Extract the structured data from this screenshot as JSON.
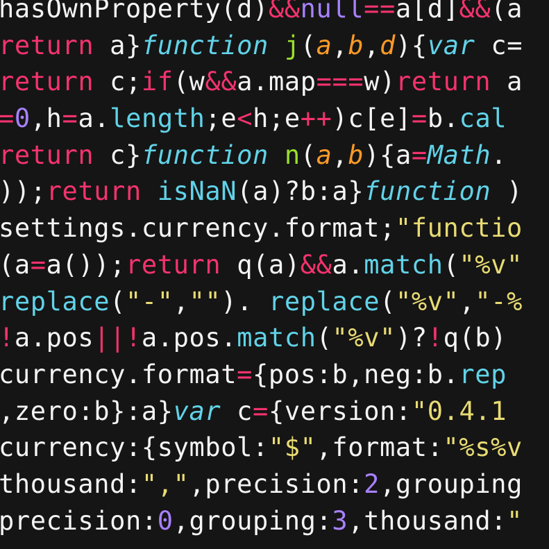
{
  "palette": {
    "background": "#151515",
    "plain": "#f4f4f4",
    "keyword": "#f4336e",
    "function_kw": "#61d3e8",
    "function_name": "#9ae02c",
    "param": "#fb9a28",
    "literal": "#a881ff",
    "string": "#e8db74"
  },
  "lines": [
    [
      [
        "plain",
        "hasOwnProperty(d)"
      ],
      [
        "op",
        "&&"
      ],
      [
        "lit",
        "null"
      ],
      [
        "op",
        "=="
      ],
      [
        "plain",
        "a[d]"
      ],
      [
        "op",
        "&&"
      ],
      [
        "plain",
        "(a"
      ]
    ],
    [
      [
        "kw",
        "return"
      ],
      [
        "plain",
        " a}"
      ],
      [
        "fn",
        "function"
      ],
      [
        "plain",
        " "
      ],
      [
        "name",
        "j"
      ],
      [
        "plain",
        "("
      ],
      [
        "param",
        "a"
      ],
      [
        "plain",
        ","
      ],
      [
        "param",
        "b"
      ],
      [
        "plain",
        ","
      ],
      [
        "param",
        "d"
      ],
      [
        "plain",
        "){"
      ],
      [
        "fn",
        "var"
      ],
      [
        "plain",
        " c="
      ]
    ],
    [
      [
        "kw",
        "return"
      ],
      [
        "plain",
        " c;"
      ],
      [
        "kw",
        "if"
      ],
      [
        "plain",
        "(w"
      ],
      [
        "op",
        "&&"
      ],
      [
        "plain",
        "a.map"
      ],
      [
        "op",
        "==="
      ],
      [
        "plain",
        "w)"
      ],
      [
        "kw",
        "return"
      ],
      [
        "plain",
        " a"
      ]
    ],
    [
      [
        "op",
        "="
      ],
      [
        "num",
        "0"
      ],
      [
        "plain",
        ",h"
      ],
      [
        "op",
        "="
      ],
      [
        "plain",
        "a."
      ],
      [
        "call",
        "length"
      ],
      [
        "plain",
        ";e"
      ],
      [
        "op",
        "<"
      ],
      [
        "plain",
        "h;e"
      ],
      [
        "op",
        "++"
      ],
      [
        "plain",
        ")c[e]"
      ],
      [
        "op",
        "="
      ],
      [
        "plain",
        "b."
      ],
      [
        "call",
        "cal"
      ]
    ],
    [
      [
        "kw",
        "return"
      ],
      [
        "plain",
        " c}"
      ],
      [
        "fn",
        "function"
      ],
      [
        "plain",
        " "
      ],
      [
        "name",
        "n"
      ],
      [
        "plain",
        "("
      ],
      [
        "param",
        "a"
      ],
      [
        "plain",
        ","
      ],
      [
        "param",
        "b"
      ],
      [
        "plain",
        "){a"
      ],
      [
        "op",
        "="
      ],
      [
        "fn",
        "Math"
      ],
      [
        "plain",
        "."
      ]
    ],
    [
      [
        "plain",
        "));"
      ],
      [
        "kw",
        "return"
      ],
      [
        "plain",
        " "
      ],
      [
        "call",
        "isNaN"
      ],
      [
        "plain",
        "(a)?b:a}"
      ],
      [
        "fn",
        "function"
      ],
      [
        "plain",
        " )"
      ]
    ],
    [
      [
        "plain",
        "settings.currency.format;"
      ],
      [
        "str",
        "\"functio"
      ]
    ],
    [
      [
        "plain",
        "(a"
      ],
      [
        "op",
        "="
      ],
      [
        "plain",
        "a());"
      ],
      [
        "kw",
        "return"
      ],
      [
        "plain",
        " q(a)"
      ],
      [
        "op",
        "&&"
      ],
      [
        "plain",
        "a."
      ],
      [
        "call",
        "match"
      ],
      [
        "plain",
        "("
      ],
      [
        "str",
        "\"%v\""
      ]
    ],
    [
      [
        "call",
        "replace"
      ],
      [
        "plain",
        "("
      ],
      [
        "str",
        "\"-\""
      ],
      [
        "plain",
        ","
      ],
      [
        "str",
        "\"\""
      ],
      [
        "plain",
        "). "
      ],
      [
        "call",
        "replace"
      ],
      [
        "plain",
        "("
      ],
      [
        "str",
        "\"%v\""
      ],
      [
        "plain",
        ","
      ],
      [
        "str",
        "\"-%"
      ]
    ],
    [
      [
        "op",
        "!"
      ],
      [
        "plain",
        "a.pos"
      ],
      [
        "op",
        "||!"
      ],
      [
        "plain",
        "a.pos."
      ],
      [
        "call",
        "match"
      ],
      [
        "plain",
        "("
      ],
      [
        "str",
        "\"%v\""
      ],
      [
        "plain",
        ")?"
      ],
      [
        "op",
        "!"
      ],
      [
        "plain",
        "q(b)"
      ]
    ],
    [
      [
        "plain",
        "currency.format"
      ],
      [
        "op",
        "="
      ],
      [
        "plain",
        "{pos:b,neg:b."
      ],
      [
        "call",
        "rep"
      ]
    ],
    [
      [
        "plain",
        ",zero:b}:a}"
      ],
      [
        "fn",
        "var"
      ],
      [
        "plain",
        " c"
      ],
      [
        "op",
        "="
      ],
      [
        "plain",
        "{version:"
      ],
      [
        "str",
        "\"0.4.1"
      ]
    ],
    [
      [
        "plain",
        "currency:{symbol:"
      ],
      [
        "str",
        "\"$\""
      ],
      [
        "plain",
        ",format:"
      ],
      [
        "str",
        "\"%s%v"
      ]
    ],
    [
      [
        "plain",
        "thousand:"
      ],
      [
        "str",
        "\",\""
      ],
      [
        "plain",
        ",precision:"
      ],
      [
        "num",
        "2"
      ],
      [
        "plain",
        ",grouping"
      ]
    ],
    [
      [
        "plain",
        "precision:"
      ],
      [
        "num",
        "0"
      ],
      [
        "plain",
        ",grouping:"
      ],
      [
        "num",
        "3"
      ],
      [
        "plain",
        ",thousand:"
      ],
      [
        "str",
        "\""
      ]
    ]
  ]
}
